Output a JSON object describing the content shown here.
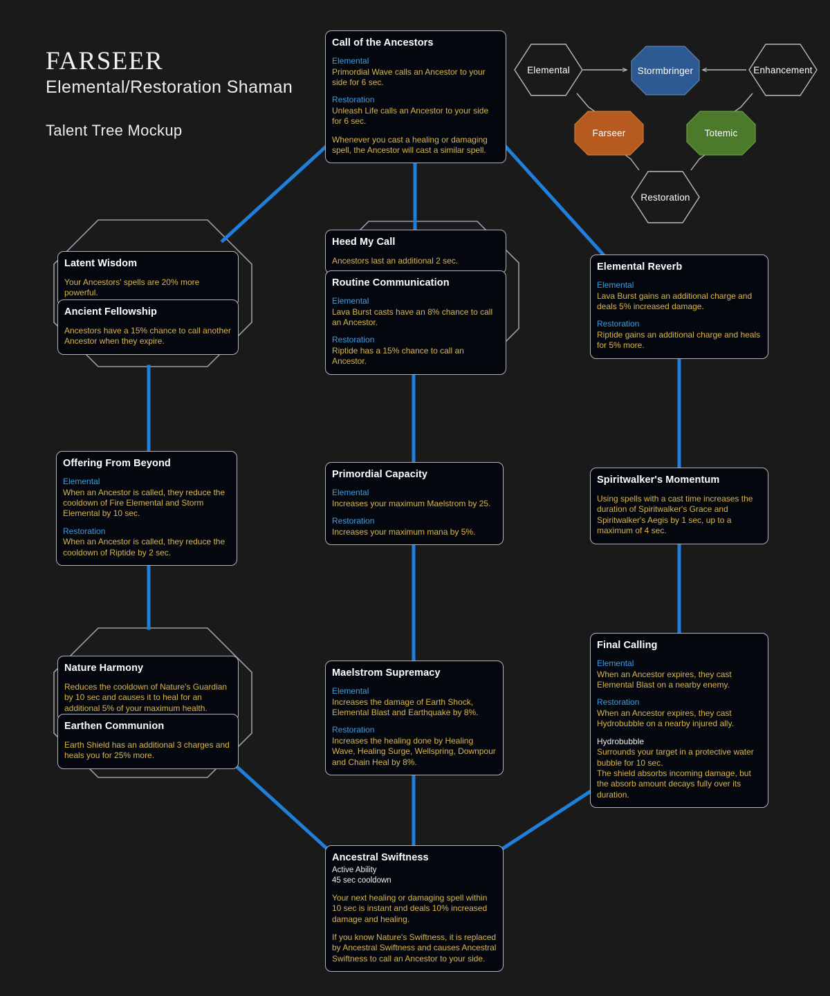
{
  "header": {
    "title": "FARSEER",
    "subtitle": "Elemental/Restoration Shaman",
    "note": "Talent Tree Mockup"
  },
  "colors": {
    "background": "#1a1a1a",
    "connector_blue": "#1f7fdb",
    "node_border": "#b2b4bd",
    "node_fill": "#05070f",
    "spec_label": "#3d9fe0",
    "body_text": "#d9b64c",
    "hex_stormbringer": "#2d5a92",
    "hex_farseer": "#b65a1f",
    "hex_totemic": "#4a7a2a"
  },
  "spec_selector": {
    "hexes": [
      {
        "id": "elemental",
        "label": "Elemental",
        "filled": false
      },
      {
        "id": "stormbringer",
        "label": "Stormbringer",
        "filled": true
      },
      {
        "id": "enhancement",
        "label": "Enhancement",
        "filled": false
      },
      {
        "id": "farseer",
        "label": "Farseer",
        "filled": true
      },
      {
        "id": "totemic",
        "label": "Totemic",
        "filled": true
      },
      {
        "id": "restoration",
        "label": "Restoration",
        "filled": false
      }
    ]
  },
  "talents": {
    "call_of_the_ancestors": {
      "title": "Call of the Ancestors",
      "spec1": "Elemental",
      "body1": "Primordial Wave calls an Ancestor to your side for 6 sec.",
      "spec2": "Restoration",
      "body2": "Unleash Life calls an Ancestor to your side for 6 sec.",
      "body3": "Whenever you cast a healing or damaging spell, the Ancestor will cast a similar spell."
    },
    "latent_wisdom": {
      "title": "Latent Wisdom",
      "body1": "Your Ancestors' spells are 20% more powerful."
    },
    "ancient_fellowship": {
      "title": "Ancient Fellowship",
      "body1": "Ancestors have a 15% chance to call another Ancestor when they expire."
    },
    "heed_my_call": {
      "title": "Heed My Call",
      "body1": "Ancestors last an additional 2 sec."
    },
    "routine_communication": {
      "title": "Routine Communication",
      "spec1": "Elemental",
      "body1": "Lava Burst casts have an 8% chance to call an Ancestor.",
      "spec2": "Restoration",
      "body2": "Riptide has a 15% chance to call an Ancestor."
    },
    "elemental_reverb": {
      "title": "Elemental Reverb",
      "spec1": "Elemental",
      "body1": "Lava Burst gains an additional charge and deals 5% increased damage.",
      "spec2": "Restoration",
      "body2": "Riptide gains an additional charge and heals for 5% more."
    },
    "offering_from_beyond": {
      "title": "Offering From Beyond",
      "spec1": "Elemental",
      "body1": "When an Ancestor is called, they reduce the cooldown of Fire Elemental and Storm Elemental by 10 sec.",
      "spec2": "Restoration",
      "body2": "When an Ancestor is called, they reduce the cooldown of Riptide by 2 sec."
    },
    "primordial_capacity": {
      "title": "Primordial Capacity",
      "spec1": "Elemental",
      "body1": "Increases your maximum Maelstrom by 25.",
      "spec2": "Restoration",
      "body2": "Increases your maximum mana by 5%."
    },
    "spiritwalkers_momentum": {
      "title": "Spiritwalker's Momentum",
      "body1": "Using spells with a cast time increases the duration of Spiritwalker's Grace and Spiritwalker's Aegis by 1 sec, up to a maximum of 4 sec."
    },
    "nature_harmony": {
      "title": "Nature Harmony",
      "body1": "Reduces the cooldown of Nature's Guardian by 10 sec and causes it to heal for an additional 5% of your maximum health."
    },
    "earthen_communion": {
      "title": "Earthen Communion",
      "body1": "Earth Shield has an additional 3 charges and heals you for 25% more."
    },
    "maelstrom_supremacy": {
      "title": "Maelstrom Supremacy",
      "spec1": "Elemental",
      "body1": "Increases the damage of Earth Shock, Elemental Blast and Earthquake by 8%.",
      "spec2": "Restoration",
      "body2": "Increases the healing done by Healing Wave, Healing Surge, Wellspring, Downpour and Chain Heal by 8%."
    },
    "final_calling": {
      "title": "Final Calling",
      "spec1": "Elemental",
      "body1": "When an Ancestor expires, they cast Elemental Blast on a nearby enemy.",
      "spec2": "Restoration",
      "body2": "When an Ancestor expires, they cast Hydrobubble on a nearby injured ally.",
      "spec3": "Hydrobubble",
      "body3": "Surrounds your target in a protective water bubble for 10 sec.",
      "body4": "The shield absorbs incoming damage, but the absorb amount decays fully over its duration."
    },
    "ancestral_swiftness": {
      "title": "Ancestral Swiftness",
      "sub1": "Active Ability",
      "sub2": "45 sec cooldown",
      "body1": "Your next healing or damaging spell within 10 sec is instant and deals 10% increased damage and healing.",
      "body2": "If you know Nature's Swiftness, it is replaced by Ancestral Swiftness and causes Ancestral Swiftness to call an Ancestor to your side."
    }
  }
}
